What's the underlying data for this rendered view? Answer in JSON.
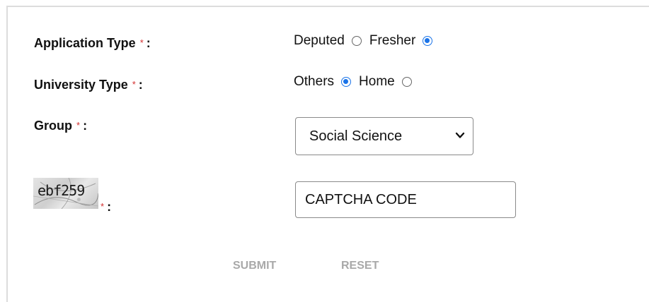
{
  "form": {
    "application_type": {
      "label": "Application Type",
      "required_mark": "*",
      "colon": ":",
      "options": [
        {
          "label": "Deputed",
          "checked": false
        },
        {
          "label": "Fresher",
          "checked": true
        }
      ]
    },
    "university_type": {
      "label": "University Type",
      "required_mark": "*",
      "colon": ":",
      "options": [
        {
          "label": "Others",
          "checked": true
        },
        {
          "label": "Home",
          "checked": false
        }
      ]
    },
    "group": {
      "label": "Group",
      "required_mark": "*",
      "colon": ":",
      "selected": "Social Science"
    },
    "captcha": {
      "image_text": "ebf259",
      "required_mark": "*",
      "colon": ":",
      "placeholder": "CAPTCHA CODE",
      "value": ""
    },
    "buttons": {
      "submit": "SUBMIT",
      "reset": "RESET"
    }
  },
  "colors": {
    "accent": "#1a73e8",
    "required": "#d32f2f",
    "button_text": "#a9a9a9",
    "border": "#dcdcdc"
  },
  "icons": {
    "select_arrow": "chevron-down-icon"
  }
}
